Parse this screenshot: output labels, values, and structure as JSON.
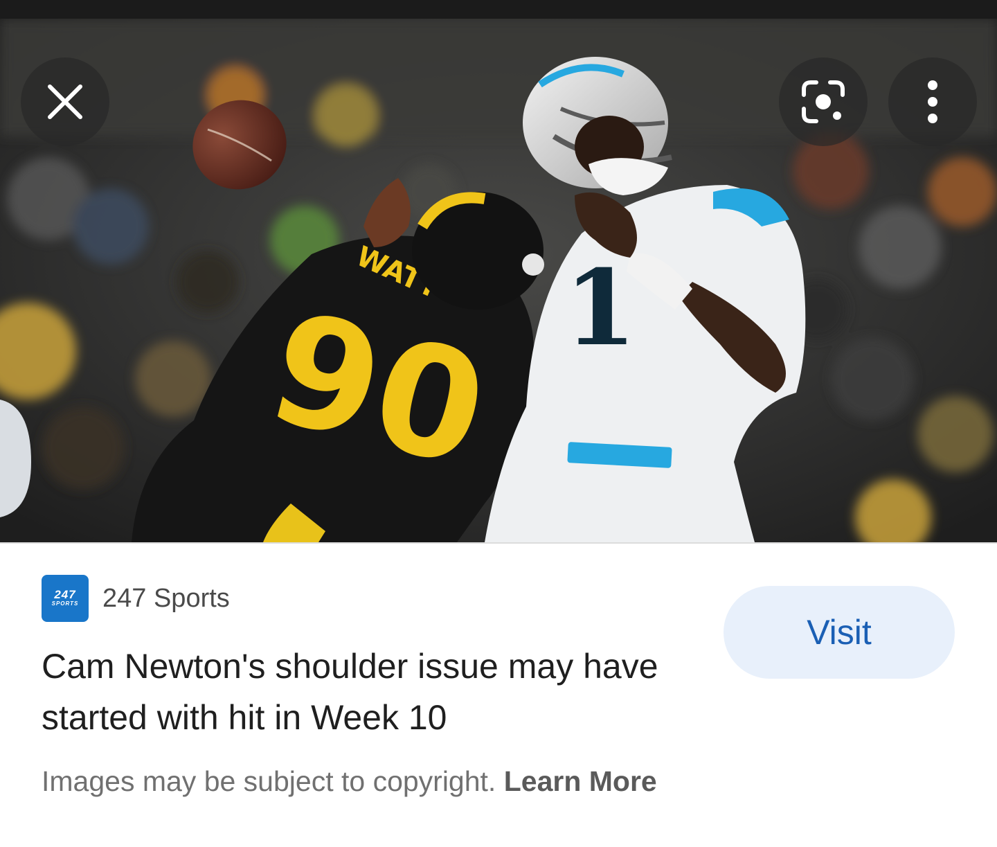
{
  "photo": {
    "subject_player_a_name": "WATT",
    "subject_player_a_number": "90",
    "subject_player_b_number": "1"
  },
  "overlay": {
    "close_icon": "close-icon",
    "lens_icon": "lens-icon",
    "more_icon": "more-vert-icon"
  },
  "source": {
    "logo_line1": "247",
    "logo_line2": "SPORTS",
    "name": "247 Sports"
  },
  "headline": "Cam Newton's shoulder issue may have started with hit in Week 10",
  "visit_label": "Visit",
  "copyright": {
    "text": "Images may be subject to copyright.",
    "link_label": "Learn More"
  },
  "colors": {
    "accent": "#1a5fb4",
    "visit_bg": "#e8f0fb",
    "logo_bg": "#1976c9"
  }
}
